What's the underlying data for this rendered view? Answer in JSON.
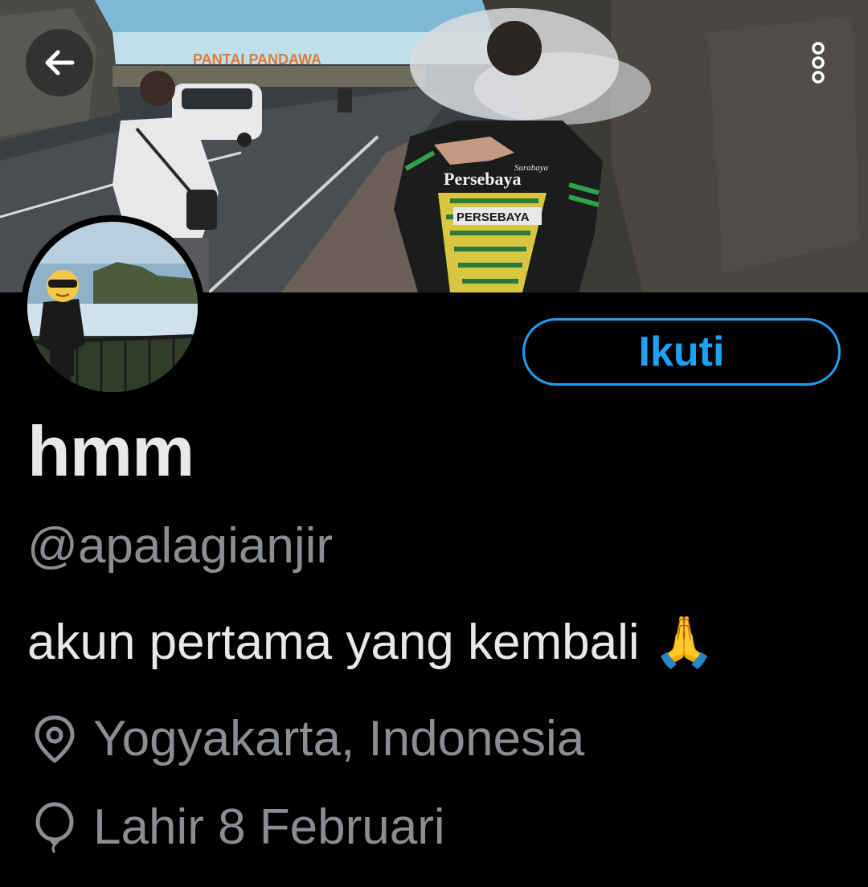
{
  "banner": {
    "sign_text": "PANTAI PANDAWA",
    "shirt_brand_top": "Surabaya",
    "shirt_text_1": "Persebaya",
    "shirt_text_2": "PERSEBAYA"
  },
  "nav": {
    "back_icon": "arrow-left-icon",
    "more_icon": "more-vertical-icon"
  },
  "profile": {
    "display_name": "hmm",
    "handle": "@apalagianjir",
    "bio": "akun pertama yang kembali 🙏",
    "location": "Yogyakarta, Indonesia",
    "birthday": "Lahir 8 Februari",
    "location_icon": "location-pin-icon",
    "birthday_icon": "balloon-icon"
  },
  "actions": {
    "follow_label": "Ikuti"
  },
  "colors": {
    "background": "#000000",
    "accent": "#1da1f2",
    "primary_text": "#e8e8e8",
    "secondary_text": "#8a8d91"
  }
}
